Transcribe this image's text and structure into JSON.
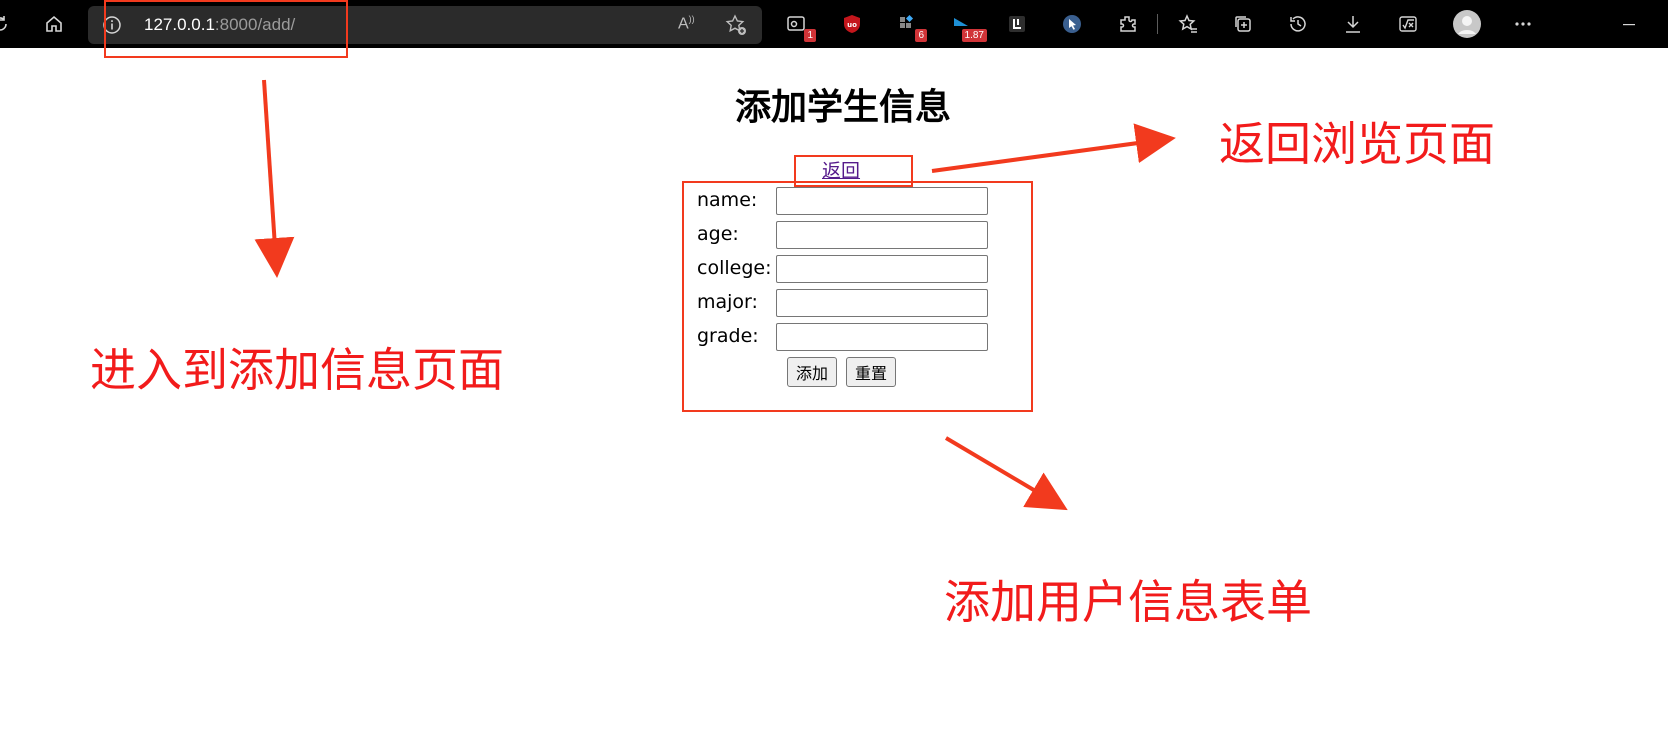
{
  "browser": {
    "url_host": "127.0.0.1",
    "url_path": ":8000/add/",
    "read_aloud_glyph": "A",
    "toolbar_icons": [
      "refresh-icon",
      "home-icon",
      "info-icon",
      "read-aloud-icon",
      "add-favorite-icon",
      "screenshot-extension-icon",
      "ublock-icon",
      "extension-puzzle-icon",
      "extension-blue-icon",
      "extension-dark-icon",
      "extension-cursor-icon",
      "extensions-icon",
      "favorites-icon",
      "collections-icon",
      "history-icon",
      "downloads-icon",
      "math-solver-icon",
      "profile-avatar",
      "more-icon",
      "minimize-icon"
    ],
    "badges": {
      "ext1": "1",
      "ext3": "6",
      "ext4": "1.87"
    }
  },
  "page": {
    "title": "添加学生信息",
    "back_link": "返回"
  },
  "form": {
    "fields": [
      {
        "label": "name:",
        "value": ""
      },
      {
        "label": "age:",
        "value": ""
      },
      {
        "label": "college:",
        "value": ""
      },
      {
        "label": "major:",
        "value": ""
      },
      {
        "label": "grade:",
        "value": ""
      }
    ],
    "submit_label": "添加",
    "reset_label": "重置"
  },
  "annotations": {
    "enter_add_page": "进入到添加信息页面",
    "back_to_browse": "返回浏览页面",
    "add_user_form": "添加用户信息表单",
    "color": "#f21b1b"
  }
}
